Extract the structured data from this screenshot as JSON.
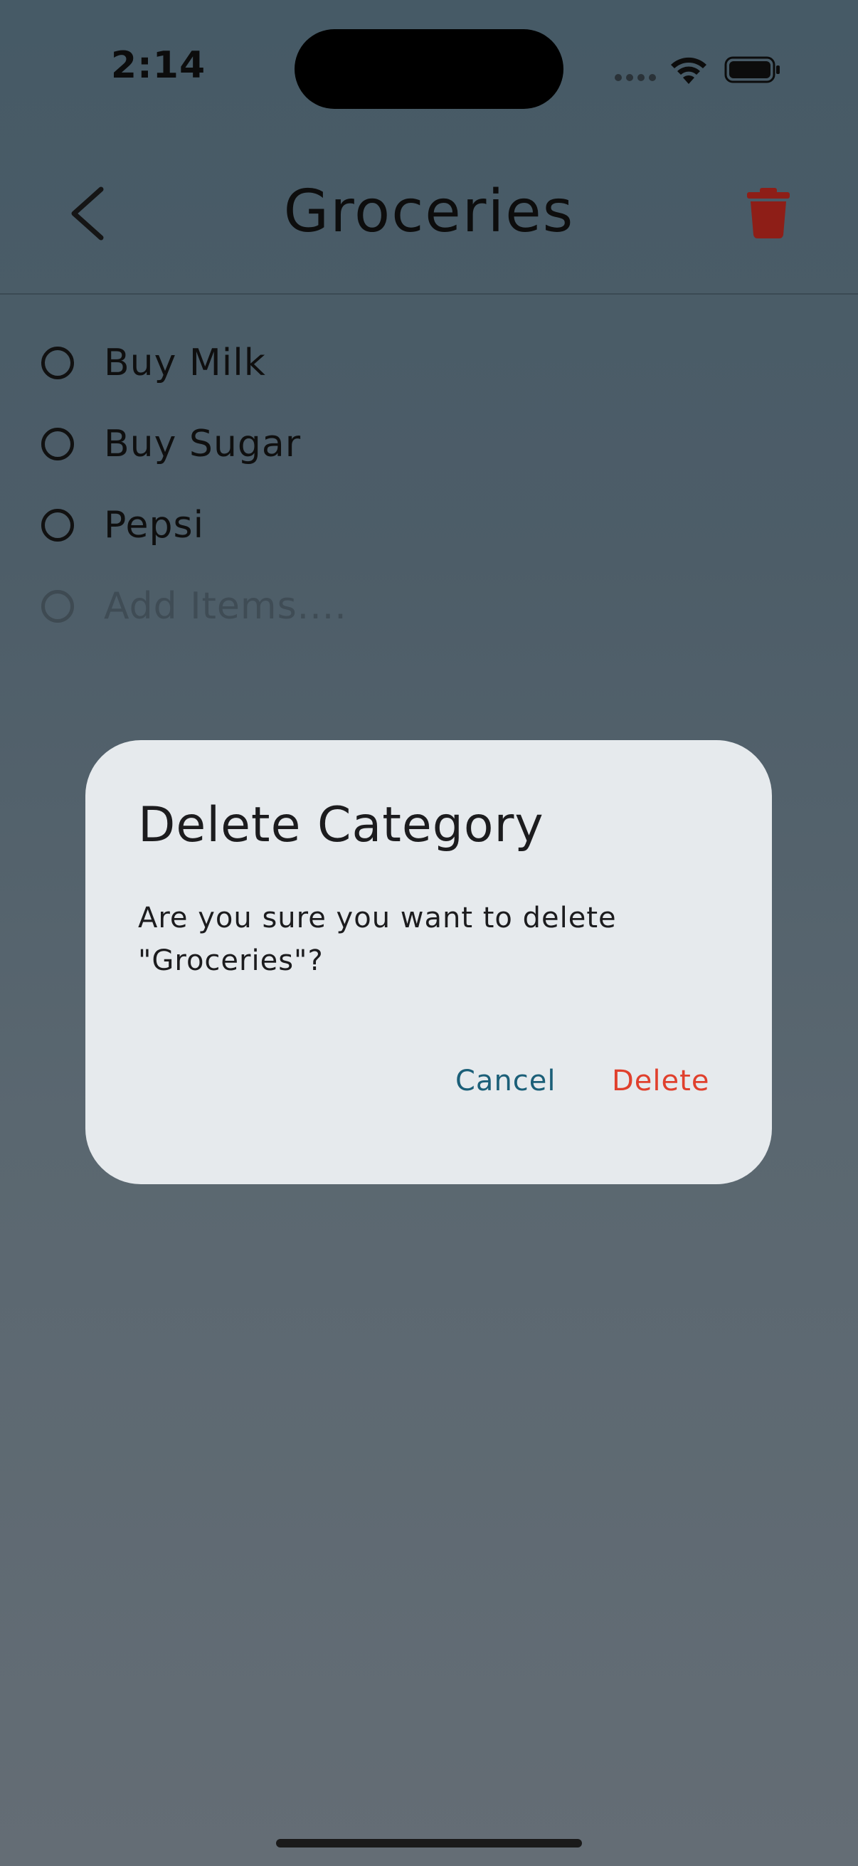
{
  "status_bar": {
    "time": "2:14"
  },
  "header": {
    "title": "Groceries",
    "back_icon": "chevron-left-icon",
    "delete_icon": "trash-icon",
    "delete_icon_color": "#8e1e17"
  },
  "list": {
    "items": [
      {
        "label": "Buy Milk",
        "checked": false
      },
      {
        "label": "Buy Sugar",
        "checked": false
      },
      {
        "label": "Pepsi",
        "checked": false
      }
    ],
    "add_placeholder": "Add Items...."
  },
  "dialog": {
    "title": "Delete Category",
    "message_line1": "Are you sure you want to delete",
    "message_line2": "\"Groceries\"?",
    "cancel_label": "Cancel",
    "delete_label": "Delete",
    "cancel_color": "#1b5f78",
    "delete_color": "#e0402d"
  }
}
